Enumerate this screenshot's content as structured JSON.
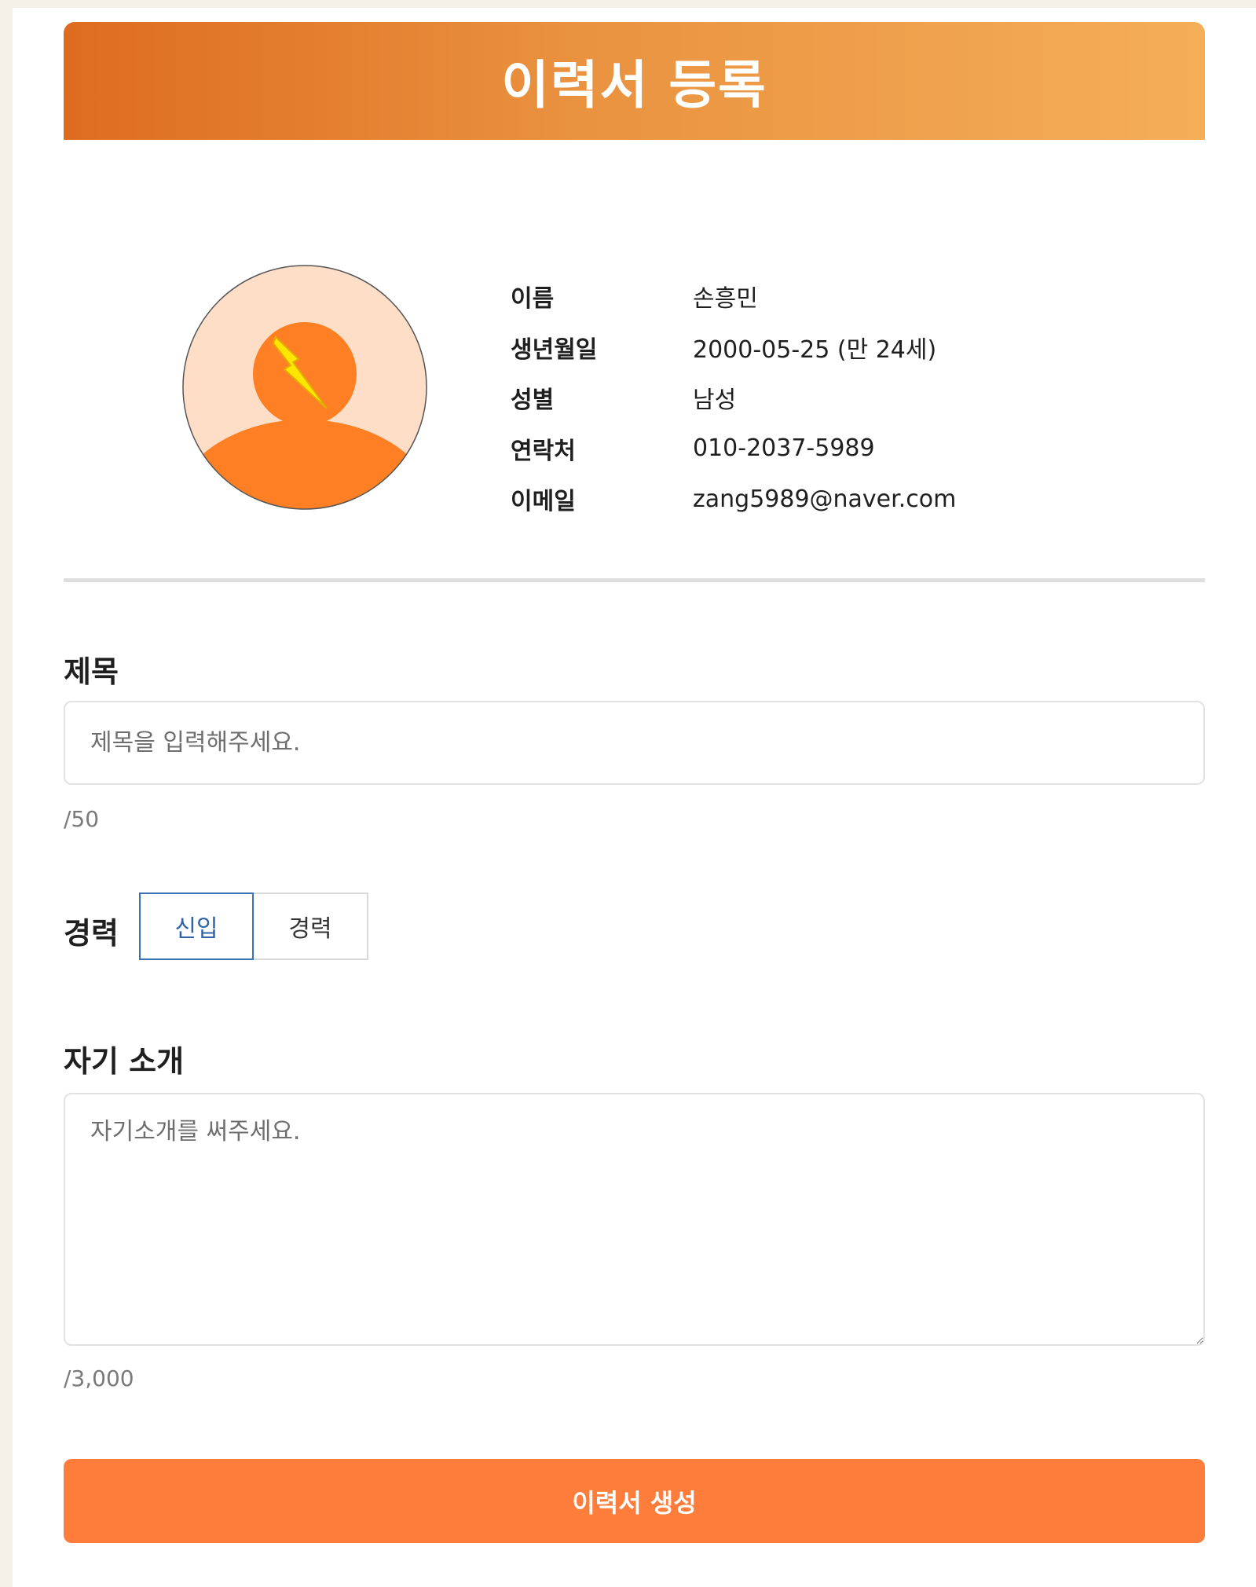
{
  "header": {
    "title": "이력서 등록"
  },
  "profile": {
    "avatar_icon": "lightning-avatar-icon",
    "fields": [
      {
        "label": "이름",
        "value": "손흥민"
      },
      {
        "label": "생년월일",
        "value": "2000-05-25 (만 24세)"
      },
      {
        "label": "성별",
        "value": "남성"
      },
      {
        "label": "연락처",
        "value": "010-2037-5989"
      },
      {
        "label": "이메일",
        "value": "zang5989@naver.com"
      }
    ]
  },
  "title_section": {
    "label": "제목",
    "placeholder": "제목을 입력해주세요.",
    "value": "",
    "counter": "/50"
  },
  "career_section": {
    "label": "경력",
    "options": [
      {
        "label": "신입",
        "selected": true
      },
      {
        "label": "경력",
        "selected": false
      }
    ]
  },
  "intro_section": {
    "label": "자기 소개",
    "placeholder": "자기소개를 써주세요.",
    "value": "",
    "counter": "/3,000"
  },
  "submit": {
    "label": "이력서 생성"
  },
  "colors": {
    "page_background": "#f5f1e8",
    "header_gradient_start": "#de6c20",
    "header_gradient_end": "#f5ae58",
    "accent": "#ff7d3b",
    "selected_toggle_border": "#3a73b4",
    "avatar_background": "#ffdec8",
    "avatar_orange": "#ff7f24",
    "lightning_yellow": "#ffe600"
  }
}
